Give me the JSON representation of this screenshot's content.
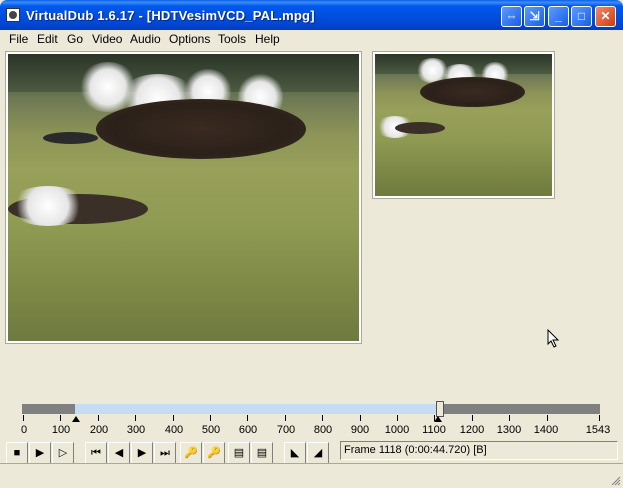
{
  "window": {
    "title": "VirtualDub 1.6.17 - [HDTVesimVCD_PAL.mpg]"
  },
  "menu": [
    "File",
    "Edit",
    "Go",
    "Video",
    "Audio",
    "Options",
    "Tools",
    "Help"
  ],
  "timeline": {
    "labels": [
      "0",
      "100",
      "200",
      "300",
      "400",
      "500",
      "600",
      "700",
      "800",
      "900",
      "1000",
      "1100",
      "1200",
      "1300",
      "1400",
      "1543"
    ],
    "current_frame": 1118,
    "total_frames": 1543,
    "selection_start": 140,
    "selection_end": 1118
  },
  "status": {
    "frame_text": "Frame 1118 (0:00:44.720) [B]"
  },
  "toolbar": {
    "buttons": [
      "stop-icon",
      "play-input-icon",
      "play-output-icon",
      "start-icon",
      "prev-frame-icon",
      "next-frame-icon",
      "end-icon",
      "prev-keyframe-icon",
      "next-keyframe-icon",
      "prev-scene-icon",
      "next-scene-icon",
      "mark-in-icon",
      "mark-out-icon"
    ]
  }
}
